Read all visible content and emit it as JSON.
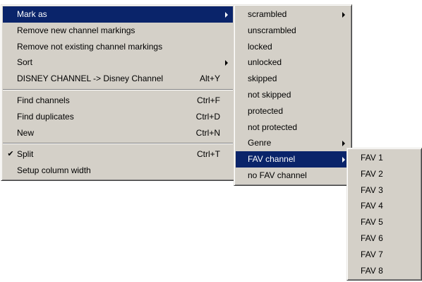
{
  "main_menu": {
    "items": [
      {
        "label": "Mark as",
        "shortcut": "",
        "checked": false
      },
      {
        "label": "Remove new channel markings",
        "shortcut": ""
      },
      {
        "label": "Remove not existing channel markings",
        "shortcut": ""
      },
      {
        "label": "Sort",
        "shortcut": ""
      },
      {
        "label": "DISNEY CHANNEL -> Disney Channel",
        "shortcut": "Alt+Y"
      },
      {
        "label": "Find channels",
        "shortcut": "Ctrl+F"
      },
      {
        "label": "Find duplicates",
        "shortcut": "Ctrl+D"
      },
      {
        "label": "New",
        "shortcut": "Ctrl+N"
      },
      {
        "label": "Split",
        "shortcut": "Ctrl+T",
        "check_mark": "✔"
      },
      {
        "label": "Setup column width",
        "shortcut": ""
      }
    ]
  },
  "mark_as_submenu": {
    "items": [
      {
        "label": "scrambled"
      },
      {
        "label": "unscrambled"
      },
      {
        "label": "locked"
      },
      {
        "label": "unlocked"
      },
      {
        "label": "skipped"
      },
      {
        "label": "not skipped"
      },
      {
        "label": "protected"
      },
      {
        "label": "not protected"
      },
      {
        "label": "Genre"
      },
      {
        "label": "FAV channel"
      },
      {
        "label": "no FAV channel"
      }
    ]
  },
  "fav_submenu": {
    "items": [
      {
        "label": "FAV 1"
      },
      {
        "label": "FAV 2"
      },
      {
        "label": "FAV 3"
      },
      {
        "label": "FAV 4"
      },
      {
        "label": "FAV 5"
      },
      {
        "label": "FAV 6"
      },
      {
        "label": "FAV 7"
      },
      {
        "label": "FAV 8"
      }
    ]
  },
  "colors": {
    "menu_background": "#d4d0c8",
    "highlight_background": "#0a246a",
    "highlight_text": "#ffffff"
  },
  "icons": {
    "submenu_arrow": "triangle-right-icon",
    "check": "checkmark-icon"
  }
}
